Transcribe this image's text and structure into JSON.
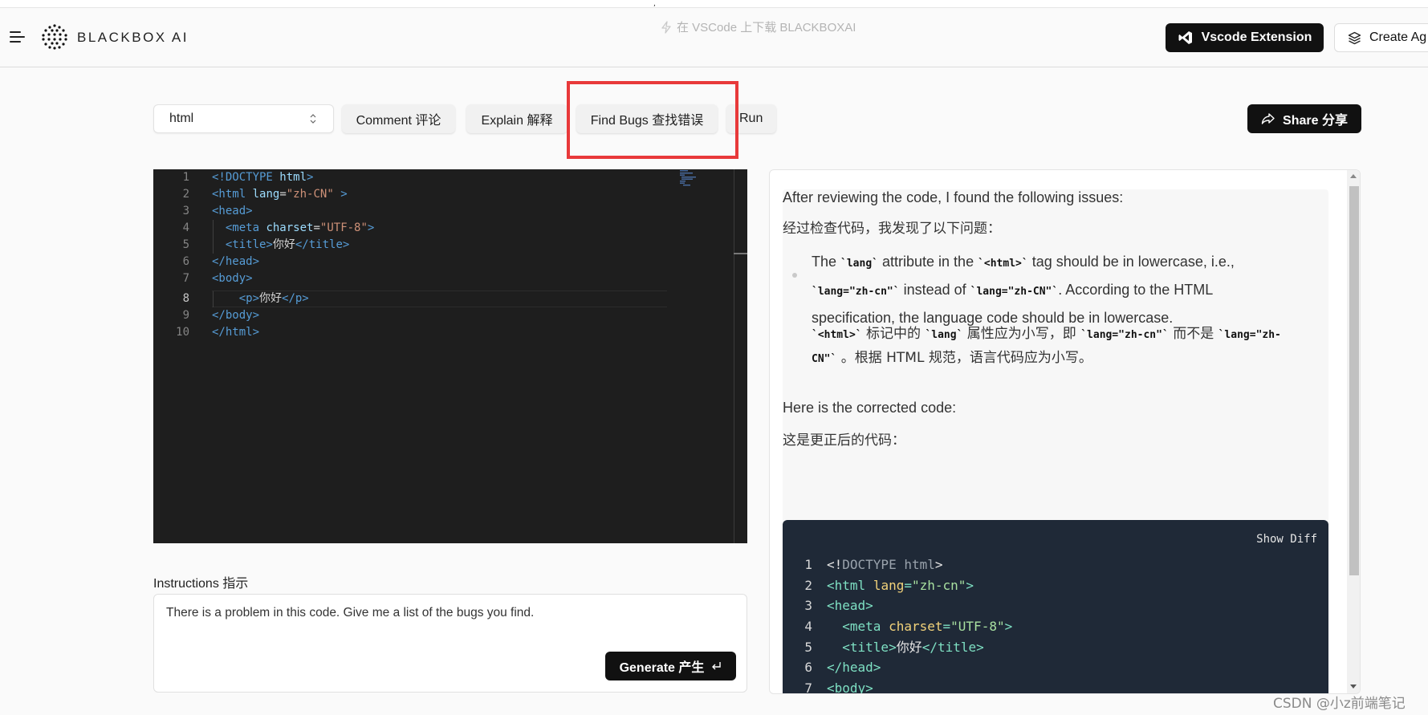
{
  "header": {
    "brand": "BLACKBOX AI",
    "banner": "在 VSCode 上下载 BLACKBOXAI",
    "vscode_button": "Vscode Extension",
    "create_button": "Create Ag"
  },
  "toolbar": {
    "language": "html",
    "comment": "Comment 评论",
    "explain": "Explain 解释",
    "find_bugs": "Find Bugs 查找错误",
    "run": "Run",
    "share": "Share 分享"
  },
  "editor": {
    "line_numbers": [
      "1",
      "2",
      "3",
      "4",
      "5",
      "6",
      "7",
      "8",
      "9",
      "10"
    ],
    "active_line": 8
  },
  "instructions": {
    "label": "Instructions 指示",
    "text": "There is a problem in this code. Give me a list of the bugs you find.",
    "generate": "Generate 产生"
  },
  "answer": {
    "intro_en": "After reviewing the code, I found the following issues:",
    "intro_zh": "经过检查代码，我发现了以下问题：",
    "bullet_en_1": "The ",
    "code_lang": "`lang`",
    "bullet_en_2": " attribute in the ",
    "code_html": "`<html>`",
    "bullet_en_3": " tag should be in lowercase, i.e.,",
    "code_lower": "`lang=\"zh-cn\"`",
    "bullet_en_4": " instead of ",
    "code_upper": "`lang=\"zh-CN\"`",
    "bullet_en_5": ". According to the HTML",
    "bullet_en_6": "specification, the language code should be in lowercase.",
    "bullet_zh_1": " 标记中的 ",
    "bullet_zh_2": " 属性应为小写，即 ",
    "bullet_zh_3": " 而不是 ",
    "code_upper_a": "`lang=\"zh-",
    "code_upper_b": "CN\"`",
    "bullet_zh_4": " 。根据 HTML 规范，语言代码应为小写。",
    "corrected_en": "Here is the corrected code:",
    "corrected_zh": "这是更正后的代码：",
    "show_diff": "Show Diff",
    "code_line_numbers": [
      "1",
      "2",
      "3",
      "4",
      "5",
      "6",
      "7"
    ]
  },
  "watermark": "CSDN @小z前端笔记"
}
